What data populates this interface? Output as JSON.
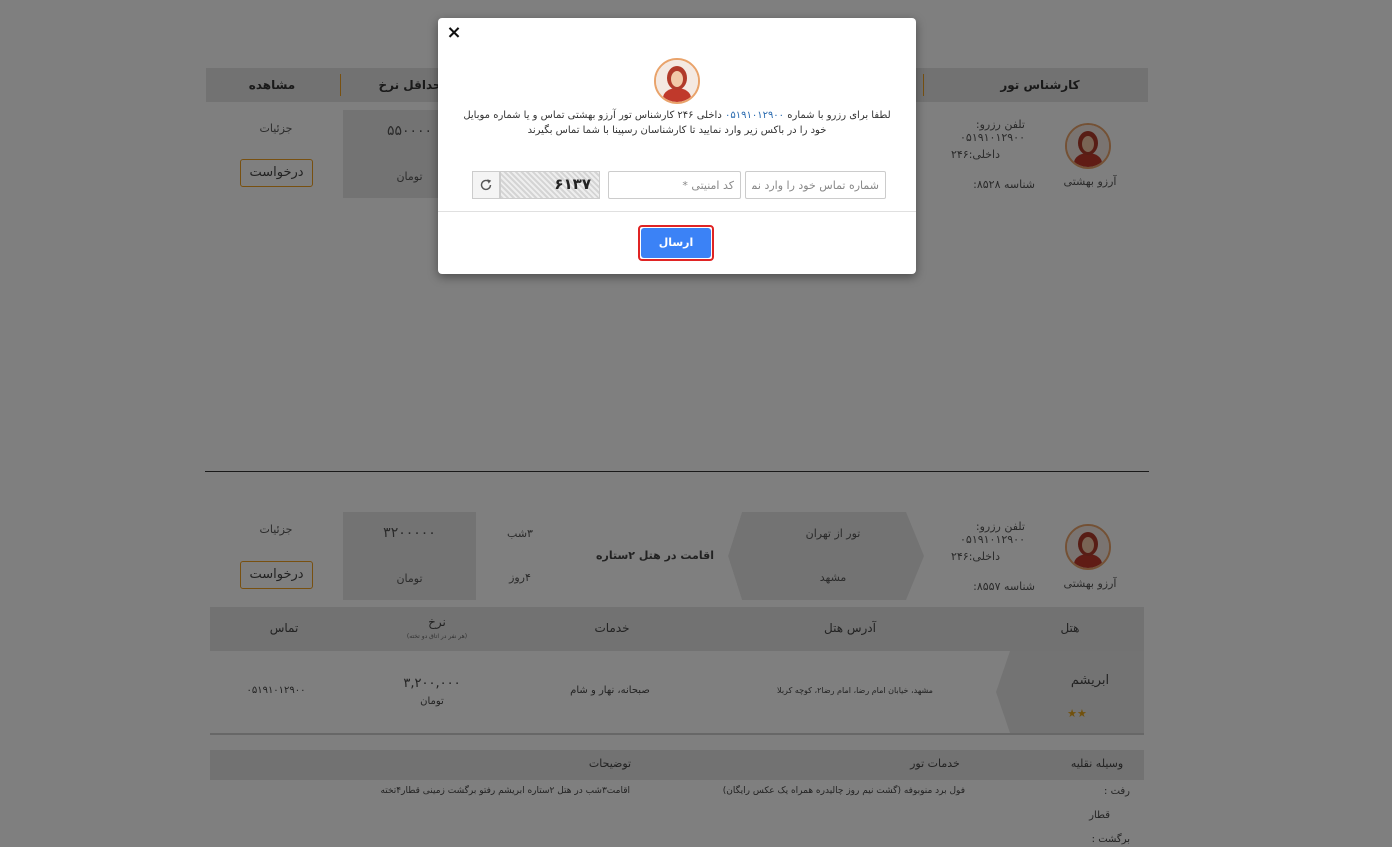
{
  "table_header": {
    "expert": "کارشناس تور",
    "min_rate": "حداقل نرخ",
    "view": "مشاهده"
  },
  "row1": {
    "expert_name": "آرزو بهشتی",
    "phone": "تلفن رزرو: ۰۵۱۹۱۰۱۲۹۰۰",
    "ext": "داخلی:۲۴۶",
    "id": "شناسه ۸۵۲۸:",
    "price": "۵۵۰۰۰۰",
    "currency": "تومان",
    "details": "جزئیات",
    "request": "درخواست"
  },
  "row2": {
    "expert_name": "آرزو بهشتی",
    "phone": "تلفن رزرو: ۰۵۱۹۱۰۱۲۹۰۰",
    "ext": "داخلی:۲۴۶",
    "id": "شناسه ۸۵۵۷:",
    "origin": "تور از تهران",
    "destination": "مشهد",
    "stay": "اقامت در هتل ۲ستاره",
    "nights": "۳شب",
    "days": "۴روز",
    "price": "۳۲۰۰۰۰۰",
    "currency": "تومان",
    "details": "جزئیات",
    "request": "درخواست"
  },
  "hotel_table": {
    "headers": {
      "hotel": "هتل",
      "address": "آدرس هتل",
      "services": "خدمات",
      "rate": "نرخ",
      "rate_note": "(هر نفر در اتاق دو تخته)",
      "contact": "تماس"
    },
    "row": {
      "name": "ابریشم",
      "stars": 2,
      "address": "مشهد، خیابان امام رضا، امام رضا۲، کوچه کربلا",
      "services": "صبحانه، نهار و شام",
      "price": "۳,۲۰۰,۰۰۰",
      "currency": "تومان",
      "phone": "۰۵۱۹۱۰۱۲۹۰۰"
    }
  },
  "transport_table": {
    "headers": {
      "vehicle": "وسیله نقلیه",
      "tour_services": "خدمات تور",
      "description": "توضیحات"
    },
    "go_label": "رفت :",
    "go_vehicle": "قطار",
    "return_label": "برگشت :",
    "tour_services_text": "فول برد منوبوفه (گشت نیم روز چالیدره همراه یک عکس رایگان)",
    "description_text": "اقامت۳شب در هتل ۲ستاره ابریشم رفتو برگشت زمینی قطار۴تخته"
  },
  "modal": {
    "close": "×",
    "message_before": "لطفا برای رزرو با شماره",
    "message_phone": "۰۵۱۹۱۰۱۲۹۰۰",
    "message_after": "داخلی ۲۴۶ کارشناس تور آرزو بهشتی تماس و یا شماره موبایل خود را در باکس زیر وارد نمایید تا کارشناسان رسپینا با شما تماس بگیرند",
    "phone_placeholder": "شماره تماس خود را وارد نمایید",
    "captcha_placeholder": "کد امنیتی *",
    "captcha_text": "۶۱۳۷",
    "submit": "ارسال"
  },
  "colors": {
    "accent": "#f0a020",
    "primary_button": "#3b82f6",
    "focus_ring": "#e02424",
    "phone_link": "#2a6bb0"
  }
}
